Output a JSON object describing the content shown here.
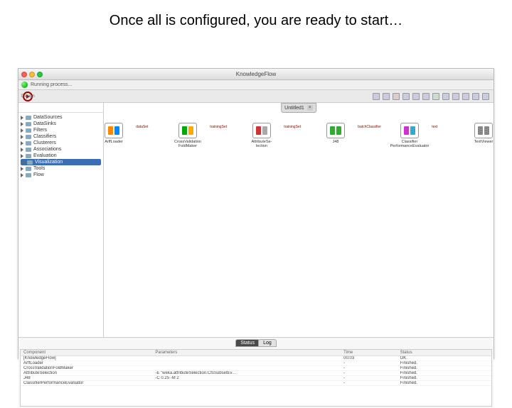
{
  "caption": "Once all is configured, you are ready to start…",
  "window_title": "KnowledgeFlow",
  "process_label": "Running process...",
  "design_label": "Design",
  "tab": {
    "label": "Untitled1",
    "close": "×"
  },
  "tree": [
    "DataSources",
    "DataSinks",
    "Filters",
    "Classifiers",
    "Clusterers",
    "Associations",
    "Evaluation",
    "Visualization",
    "Tools",
    "Flow"
  ],
  "tree_selected_index": 7,
  "nodes": [
    {
      "label": "ArffLoader"
    },
    {
      "label": "CrossValidation\nFoldMaker"
    },
    {
      "label": "AttributeSe-\nlection"
    },
    {
      "label": "J48"
    },
    {
      "label": "Classifier\nPerformanceEvaluator"
    },
    {
      "label": "TextViewer"
    }
  ],
  "connections": [
    "dataSet",
    "trainingSet",
    "trainingSet",
    "batchClassifier",
    "text"
  ],
  "bottom_tabs": {
    "a": "Status",
    "b": "Log"
  },
  "log": {
    "headers": {
      "c": "Component",
      "p": "Parameters",
      "t": "Time",
      "s": "Status"
    },
    "rows": [
      {
        "c": "[KnowledgeFlow]",
        "p": "",
        "t": "00:03",
        "s": "OK."
      },
      {
        "c": "ArffLoader",
        "p": "",
        "t": "-",
        "s": "Finished."
      },
      {
        "c": "CrossValidationFoldMaker",
        "p": "",
        "t": "-",
        "s": "Finished."
      },
      {
        "c": "AttributeSelection",
        "p": "-E \"weka.attributeSelection.CfsSubsetEv…",
        "t": "-",
        "s": "Finished."
      },
      {
        "c": "J48",
        "p": "-C 0.25 -M 2",
        "t": "-",
        "s": "Finished."
      },
      {
        "c": "ClassifierPerformanceEvaluator",
        "p": "",
        "t": "-",
        "s": "Finished."
      }
    ]
  }
}
